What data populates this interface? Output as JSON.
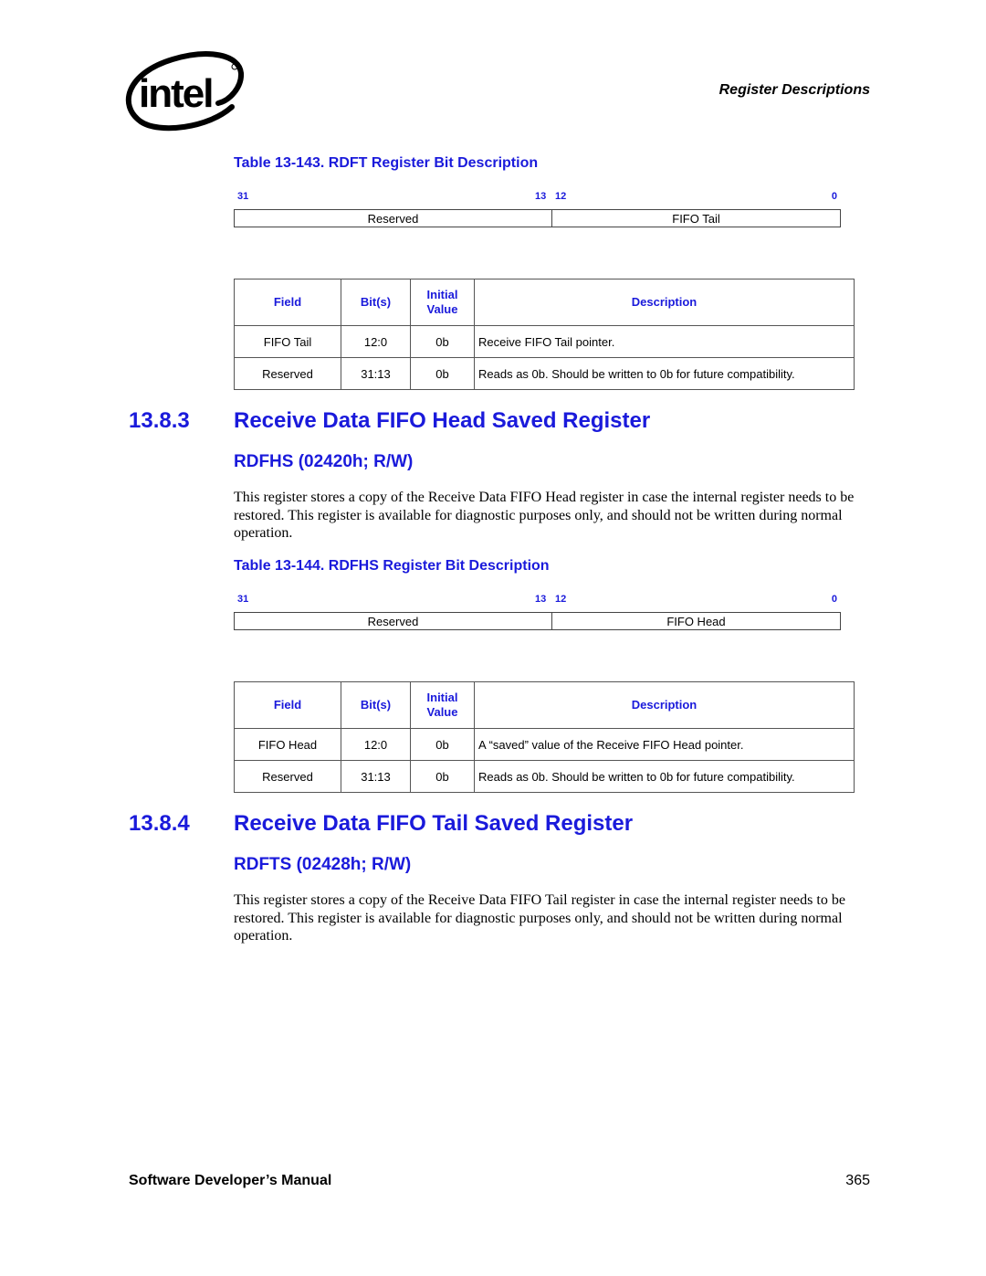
{
  "header": {
    "logo": "intel-logo",
    "section": "Register Descriptions"
  },
  "table143": {
    "caption": "Table 13-143. RDFT Register Bit Description",
    "bits": {
      "msb": "31",
      "mid_hi": "13",
      "mid_lo": "12",
      "lsb": "0"
    },
    "fields": {
      "left": "Reserved",
      "right": "FIFO Tail"
    },
    "headers": {
      "field": "Field",
      "bits": "Bit(s)",
      "initial": "Initial Value",
      "description": "Description"
    },
    "rows": [
      {
        "field": "FIFO Tail",
        "bits": "12:0",
        "initial": "0b",
        "description": "Receive FIFO Tail pointer."
      },
      {
        "field": "Reserved",
        "bits": "31:13",
        "initial": "0b",
        "description": "Reads as 0b. Should be written to 0b for future compatibility."
      }
    ]
  },
  "section1383": {
    "number": "13.8.3",
    "title": "Receive Data FIFO Head Saved Register",
    "subtitle": "RDFHS (02420h; R/W)",
    "body": "This register stores a copy of the Receive Data FIFO Head register in case the internal register needs to be restored. This register is available for diagnostic purposes only, and should not be written during normal operation."
  },
  "table144": {
    "caption": "Table 13-144. RDFHS Register Bit Description",
    "bits": {
      "msb": "31",
      "mid_hi": "13",
      "mid_lo": "12",
      "lsb": "0"
    },
    "fields": {
      "left": "Reserved",
      "right": "FIFO Head"
    },
    "headers": {
      "field": "Field",
      "bits": "Bit(s)",
      "initial": "Initial Value",
      "description": "Description"
    },
    "rows": [
      {
        "field": "FIFO Head",
        "bits": "12:0",
        "initial": "0b",
        "description": "A “saved” value of the Receive FIFO Head pointer."
      },
      {
        "field": "Reserved",
        "bits": "31:13",
        "initial": "0b",
        "description": "Reads as 0b. Should be written to 0b for future compatibility."
      }
    ]
  },
  "section1384": {
    "number": "13.8.4",
    "title": "Receive Data FIFO Tail Saved Register",
    "subtitle": "RDFTS (02428h; R/W)",
    "body": "This register stores a copy of the Receive Data FIFO Tail register in case the internal register needs to be restored. This register is available for diagnostic purposes only, and should not be written during normal operation."
  },
  "footer": {
    "title": "Software Developer’s Manual",
    "page": "365"
  }
}
